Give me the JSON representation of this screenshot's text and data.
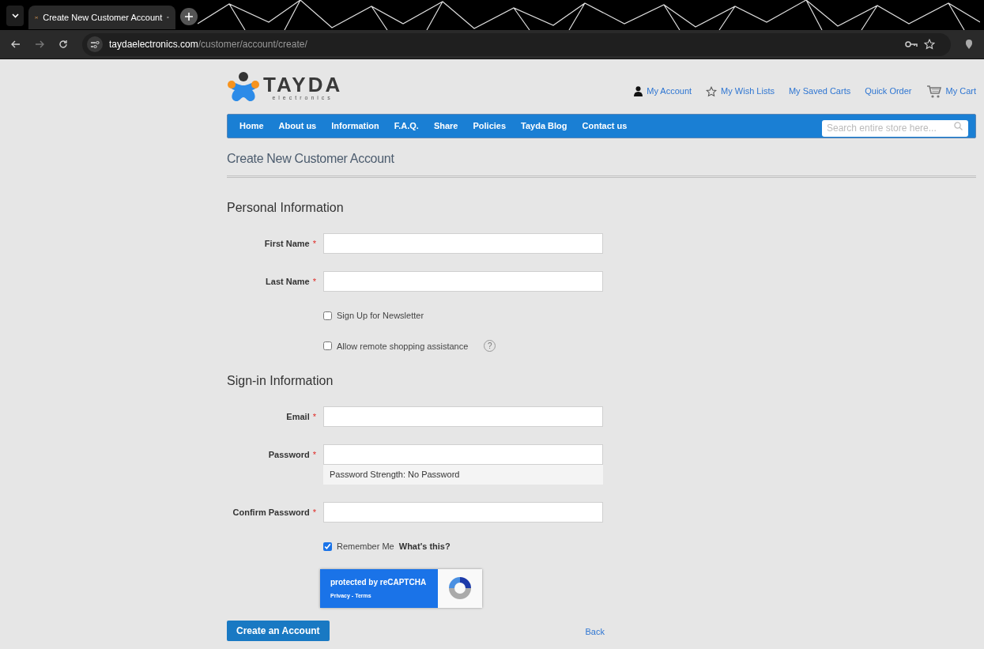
{
  "browser": {
    "tab_title": "Create New Customer Account",
    "url_domain": "taydaelectronics.com",
    "url_path": "/customer/account/create/"
  },
  "logo": {
    "name": "TAYDA",
    "tagline": "electronics"
  },
  "header_links": [
    {
      "label": "My Account",
      "kind": "account"
    },
    {
      "label": "My Wish Lists",
      "kind": "wishlist"
    },
    {
      "label": "My Saved Carts",
      "kind": "plain"
    },
    {
      "label": "Quick Order",
      "kind": "plain"
    },
    {
      "label": "My Cart",
      "kind": "cart"
    }
  ],
  "nav": {
    "items": [
      "Home",
      "About us",
      "Information",
      "F.A.Q.",
      "Share",
      "Policies",
      "Tayda Blog",
      "Contact us"
    ],
    "search": {
      "placeholder": "Search entire store here..."
    }
  },
  "page_title": "Create New Customer Account",
  "sections": [
    {
      "title": "Personal Information",
      "fields": [
        {
          "kind": "text",
          "label": "First Name",
          "required_mark": "*"
        },
        {
          "kind": "text",
          "label": "Last Name",
          "required_mark": "*"
        },
        {
          "kind": "checkbox",
          "label": "Sign Up for Newsletter",
          "checked": false
        },
        {
          "kind": "checkbox",
          "label": "Allow remote shopping assistance",
          "checked": false,
          "help_icon": "?"
        }
      ]
    },
    {
      "title": "Sign-in Information",
      "fields": [
        {
          "kind": "text",
          "label": "Email",
          "required_mark": "*"
        },
        {
          "kind": "text",
          "label": "Password",
          "required_mark": "*",
          "note": "Password Strength: No Password"
        },
        {
          "kind": "text",
          "label": "Confirm Password",
          "required_mark": "*"
        },
        {
          "kind": "checkbox",
          "label": "Remember Me",
          "checked": true,
          "link": "What's this?"
        }
      ]
    }
  ],
  "recaptcha": {
    "title": "protected by reCAPTCHA",
    "links": "Privacy - Terms"
  },
  "actions": {
    "submit": "Create an Account",
    "back": "Back"
  }
}
